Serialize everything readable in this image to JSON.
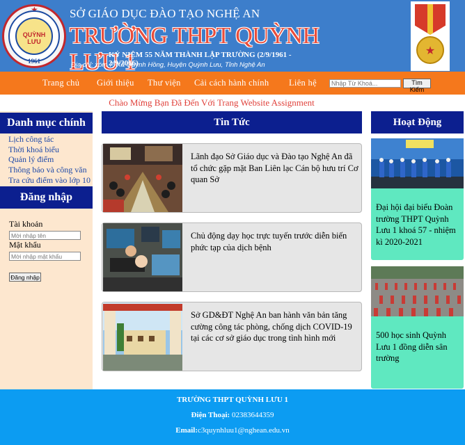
{
  "banner": {
    "logo_text": "QUỲNH LƯU",
    "logo_year": "1961",
    "department": "SỞ GIÁO DỤC ĐÀO TẠO NGHỆ AN",
    "school": "TRƯỜNG THPT QUỲNH LƯU 1",
    "anniversary": "KỶ NIỆM 55 NĂM THÀNH LẬP TRƯỜNG (2/9/1961 - 2/9/2016)",
    "address": "Địa chỉ: xóm 7, Xã Quỳnh Hồng,  Huyện Quỳnh Lưu, Tỉnh Nghệ An"
  },
  "nav": {
    "items": [
      "Trang chủ",
      "Giới thiệu",
      "Thư viện",
      "Cải cách hành chính",
      "Liên hệ"
    ],
    "search_placeholder": "Nhập Từ Khoá...",
    "search_button": "Tìm Kiếm"
  },
  "welcome": "Chào Mừng Bạn Đã Đến Với Trang Website Assignment",
  "sidebar": {
    "menu_title": "Danh mục chính",
    "menu_items": [
      "Lịch công tác",
      "Thời khoá biểu",
      "Quản lý điểm",
      "Thông báo và công văn",
      "Tra cứu điểm vào lớp 10"
    ],
    "login_title": "Đăng nhập",
    "username_label": "Tài khoản",
    "username_placeholder": "Mời nhập tên",
    "password_label": "Mật khẩu",
    "password_placeholder": "Mời nhập mật khẩu",
    "login_button": "Đăng nhập"
  },
  "news": {
    "title": "Tin Tức",
    "items": [
      "Lãnh đạo Sở Giáo dục và Đào tạo Nghệ An đã tổ chức gặp mặt Ban Liên lạc Cán bộ hưu trí Cơ quan Sở",
      "Chủ động dạy học trực tuyến trước diễn biến phức tạp của dịch bệnh",
      "Sở GD&ĐT Nghệ An ban hành văn bản tăng cường công tác phòng, chống dịch COVID-19 tại các cơ sở giáo dục trong tình hình mới"
    ]
  },
  "activities": {
    "title": "Hoạt Động",
    "items": [
      "Đại hội đại biểu Đoàn trường THPT Quỳnh Lưu 1 khoá 57 - nhiệm kì 2020-2021",
      "500 học sinh Quỳnh Lưu 1 đồng diễn sân trường"
    ]
  },
  "footer": {
    "school": "TRƯỜNG THPT QUỲNH LƯU 1",
    "phone_label": "Điện Thoại:",
    "phone": " 02383644359",
    "email_label": "Email:",
    "email": "c3quynhluu1@nghean.edu.vn"
  },
  "colors": {
    "banner": "#3d7ecb",
    "nav": "#f5781c",
    "panel_head": "#0c1f8f",
    "sidebar": "#fde7cf",
    "activity_card": "#5fe8c0",
    "footer": "#0c9cf2"
  }
}
